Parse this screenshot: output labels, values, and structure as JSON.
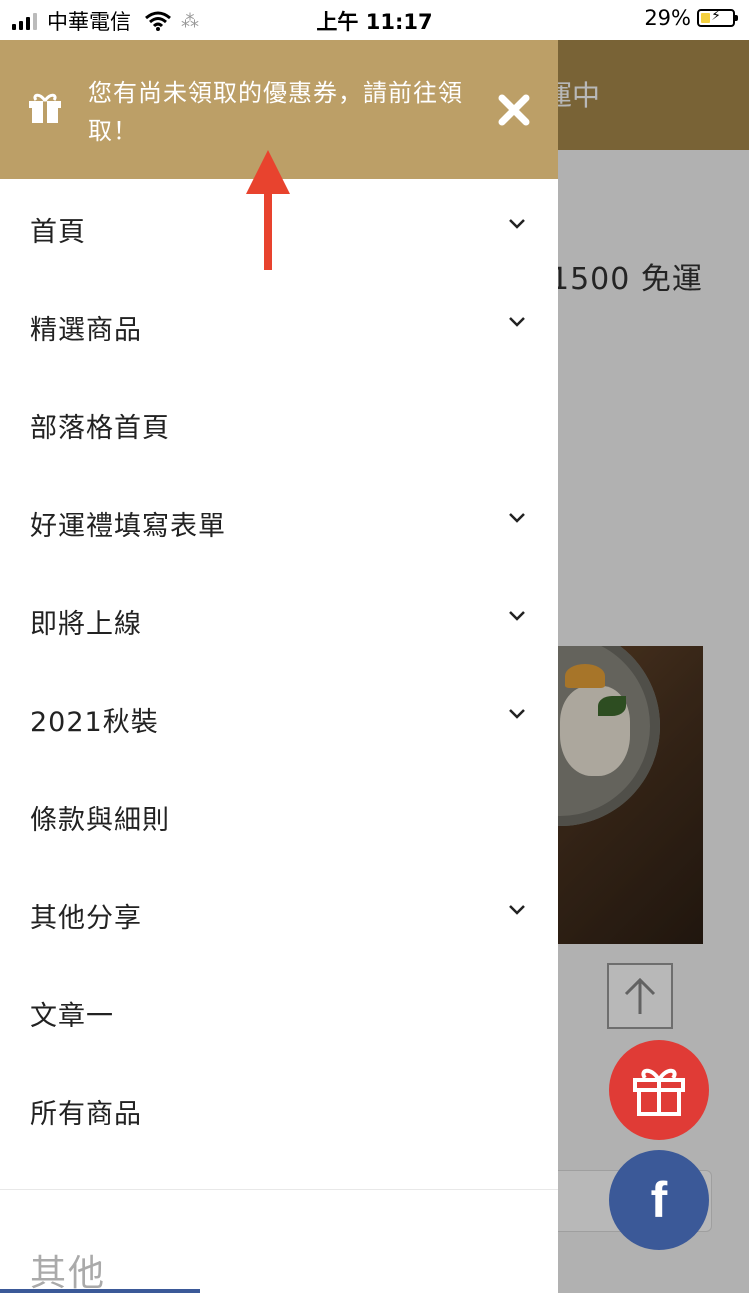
{
  "status_bar": {
    "carrier": "中華電信",
    "time": "上午 11:17",
    "battery": "29%",
    "battery_level": 0.29
  },
  "background": {
    "header_text": "運中",
    "promo_text": "1500 免運"
  },
  "coupon": {
    "message": "您有尚未領取的優惠券，請前往領取！",
    "icon": "gift-icon",
    "close_icon": "close-icon",
    "color": "#bc9f67"
  },
  "menu": {
    "items": [
      {
        "label": "首頁",
        "has_submenu": true
      },
      {
        "label": "精選商品",
        "has_submenu": true
      },
      {
        "label": "部落格首頁",
        "has_submenu": false
      },
      {
        "label": "好運禮填寫表單",
        "has_submenu": true
      },
      {
        "label": "即將上線",
        "has_submenu": true
      },
      {
        "label": "2021秋裝",
        "has_submenu": true
      },
      {
        "label": "條款與細則",
        "has_submenu": false
      },
      {
        "label": "其他分享",
        "has_submenu": true
      },
      {
        "label": "文章一",
        "has_submenu": false
      },
      {
        "label": "所有商品",
        "has_submenu": false
      }
    ],
    "section_other": "其他"
  },
  "fab": {
    "gift_icon": "gift-icon",
    "facebook_label": "f",
    "gift_color": "#e03b36",
    "facebook_color": "#3b5998"
  }
}
